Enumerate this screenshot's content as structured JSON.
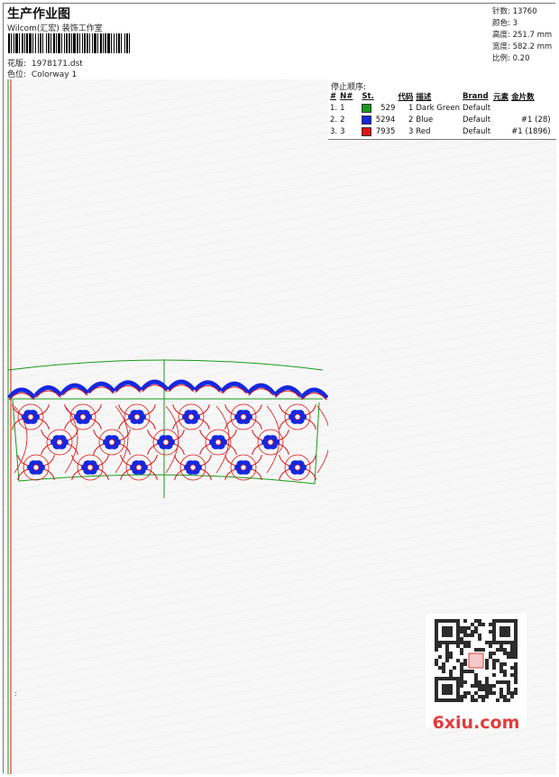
{
  "header": {
    "title": "生产作业图",
    "company": "Wilcom(汇宏) 装饰工作室",
    "design_label": "花版:",
    "design_value": "1978171.dst",
    "colorway_label": "色位:",
    "colorway_value": "Colorway 1"
  },
  "stats": {
    "stitches": "针数: 13760",
    "colors": "颜色: 3",
    "height": "高度: 251.7 mm",
    "width": "宽度: 582.2 mm",
    "scale": "比例: 0.20"
  },
  "stop_sequence": {
    "title": "停止顺序:",
    "headers": [
      "#",
      "N#",
      "St.",
      "代码",
      "描述",
      "Brand",
      "元素",
      "金片数"
    ],
    "rows": [
      {
        "num": "1.",
        "n": "1",
        "color": "#1a9a1a",
        "st": "529",
        "code": "1",
        "desc": "Dark Green",
        "brand": "Default",
        "element": "",
        "sequins": ""
      },
      {
        "num": "2.",
        "n": "2",
        "color": "#1428e0",
        "st": "5294",
        "code": "2",
        "desc": "Blue",
        "brand": "Default",
        "element": "",
        "sequins": "#1 (28)"
      },
      {
        "num": "3.",
        "n": "3",
        "color": "#e01414",
        "st": "7935",
        "code": "3",
        "desc": "Red",
        "brand": "Default",
        "element": "",
        "sequins": "#1 (1896)"
      }
    ]
  },
  "watermark": {
    "site": "6xiu.com",
    "stamp": "刺绣图库"
  },
  "colors": {
    "green": "#1a9a1a",
    "blue": "#1428e0",
    "red": "#e01414"
  }
}
